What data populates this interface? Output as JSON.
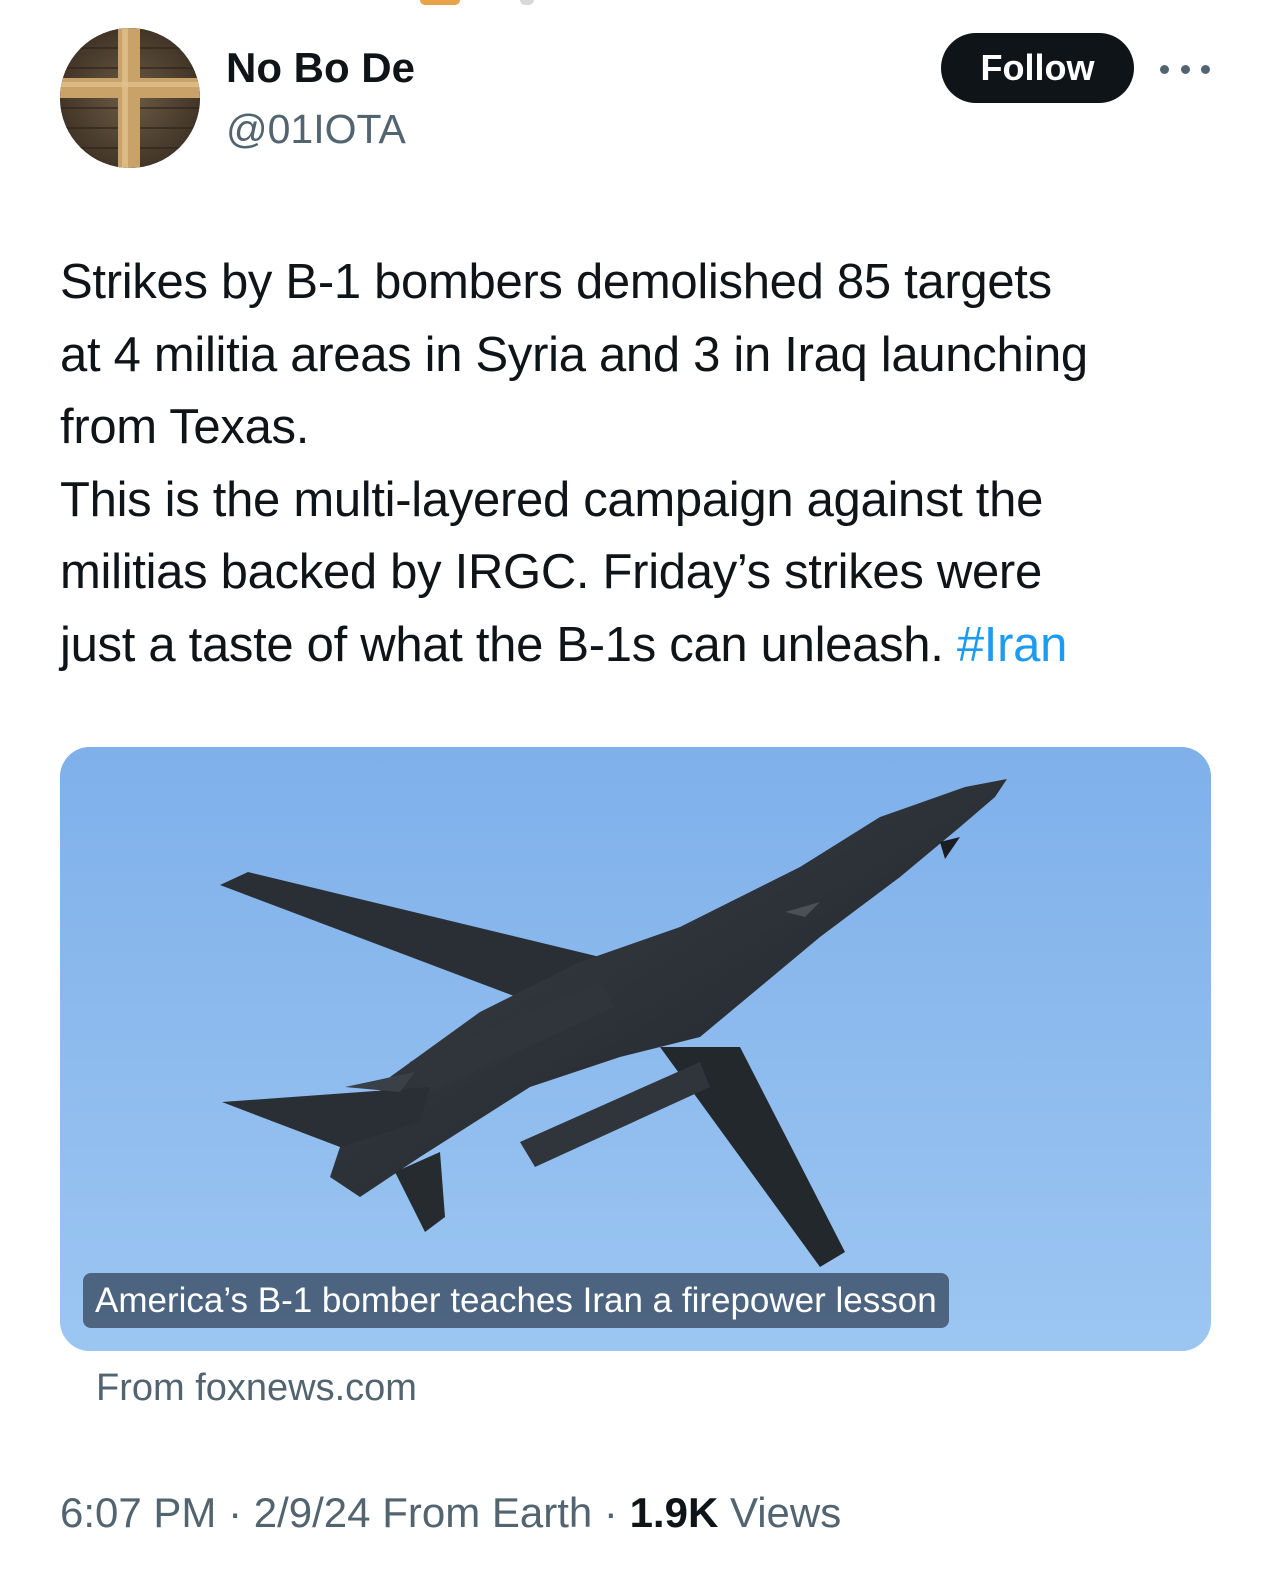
{
  "author": {
    "display_name": "No Bo De",
    "handle": "@01IOTA"
  },
  "actions": {
    "follow_label": "Follow",
    "more_icon": "more-horizontal-icon"
  },
  "tweet": {
    "lines_para1": [
      "Strikes by B-1 bombers demolished 85 targets",
      "at 4 militia areas in Syria and 3 in Iraq launching",
      "from Texas."
    ],
    "lines_para2": [
      "This is the multi-layered campaign against the",
      "militias backed by IRGC. Friday’s strikes were"
    ],
    "last_line_text": "just a taste of what the B-1s can unleash. ",
    "hashtag": "#Iran"
  },
  "card": {
    "caption": "America’s B-1 bomber teaches Iran a firepower lesson",
    "source": "From foxnews.com"
  },
  "meta": {
    "time": "6:07 PM",
    "sep1": " · ",
    "date": "2/9/24",
    "location": " From Earth",
    "sep2": " · ",
    "views_count": "1.9K",
    "views_label": " Views"
  },
  "colors": {
    "text_primary": "#0f1419",
    "text_secondary": "#536471",
    "link": "#1d9bf0",
    "sky": "#8cb8ec"
  }
}
